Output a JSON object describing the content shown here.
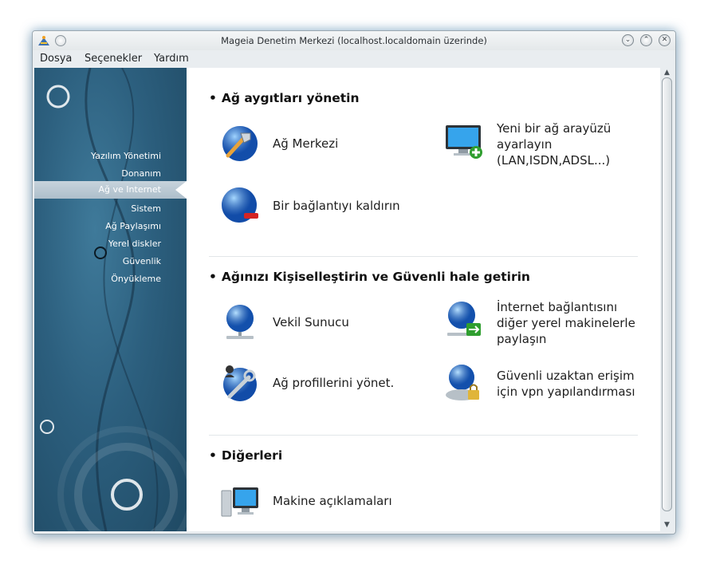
{
  "window": {
    "title": "Mageia Denetim Merkezi  (localhost.localdomain üzerinde)",
    "buttons": {
      "minimize": "⌄",
      "maximize": "⌃",
      "close": "✕"
    }
  },
  "menubar": {
    "items": [
      {
        "label": "Dosya"
      },
      {
        "label": "Seçenekler"
      },
      {
        "label": "Yardım"
      }
    ]
  },
  "sidebar": {
    "items": [
      {
        "label": "Yazılım Yönetimi"
      },
      {
        "label": "Donanım"
      },
      {
        "label": "Ağ ve Internet",
        "active": true
      },
      {
        "label": "Sistem"
      },
      {
        "label": "Ağ Paylaşımı"
      },
      {
        "label": "Yerel diskler"
      },
      {
        "label": "Güvenlik"
      },
      {
        "label": "Önyükleme"
      }
    ]
  },
  "content": {
    "sections": [
      {
        "title": "Ağ aygıtları yönetin",
        "entries": [
          {
            "label": "Ağ Merkezi",
            "icon": "network-center-icon"
          },
          {
            "label": "Yeni bir ağ arayüzü\nayarlayın\n(LAN,ISDN,ADSL...)",
            "icon": "new-interface-icon"
          },
          {
            "label": "Bir bağlantıyı kaldırın",
            "icon": "remove-connection-icon"
          }
        ]
      },
      {
        "title": "Ağınızı Kişiselleştirin ve Güvenli hale getirin",
        "entries": [
          {
            "label": "Vekil Sunucu",
            "icon": "proxy-icon"
          },
          {
            "label": "İnternet bağlantısını\ndiğer yerel makinelerle\npaylaşın",
            "icon": "share-connection-icon"
          },
          {
            "label": "Ağ profillerini yönet.",
            "icon": "network-profiles-icon"
          },
          {
            "label": "Güvenli uzaktan erişim\niçin vpn yapılandırması",
            "icon": "vpn-icon"
          }
        ]
      },
      {
        "title": "Diğerleri",
        "entries": [
          {
            "label": "Makine açıklamaları",
            "icon": "host-definitions-icon"
          }
        ]
      }
    ]
  }
}
